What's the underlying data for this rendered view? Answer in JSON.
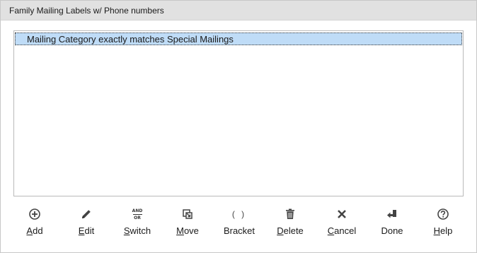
{
  "window": {
    "title": "Family Mailing Labels w/ Phone numbers"
  },
  "criteria": {
    "items": [
      {
        "text": "Mailing Category exactly matches Special Mailings"
      }
    ]
  },
  "toolbar": {
    "buttons": [
      {
        "id": "add",
        "key": "A",
        "rest": "dd",
        "icon": "plus-circle-icon"
      },
      {
        "id": "edit",
        "key": "E",
        "rest": "dit",
        "icon": "pencil-icon"
      },
      {
        "id": "switch",
        "key": "S",
        "rest": "witch",
        "icon": "and-or-icon",
        "icon_top": "AND",
        "icon_bottom": "OR"
      },
      {
        "id": "move",
        "key": "M",
        "rest": "ove",
        "icon": "move-icon"
      },
      {
        "id": "bracket",
        "key": "",
        "rest": "Bracket",
        "icon": "parentheses-icon",
        "icon_text": "( )"
      },
      {
        "id": "delete",
        "key": "D",
        "rest": "elete",
        "icon": "trash-icon"
      },
      {
        "id": "cancel",
        "key": "C",
        "rest": "ancel",
        "icon": "x-icon"
      },
      {
        "id": "done",
        "key": "",
        "rest": "Done",
        "icon": "return-arrow-icon"
      },
      {
        "id": "help",
        "key": "H",
        "rest": "elp",
        "icon": "question-circle-icon"
      }
    ]
  },
  "colors": {
    "titlebar_bg": "#e1e1e1",
    "selection_bg": "#bfdcf7",
    "icon": "#444444"
  }
}
